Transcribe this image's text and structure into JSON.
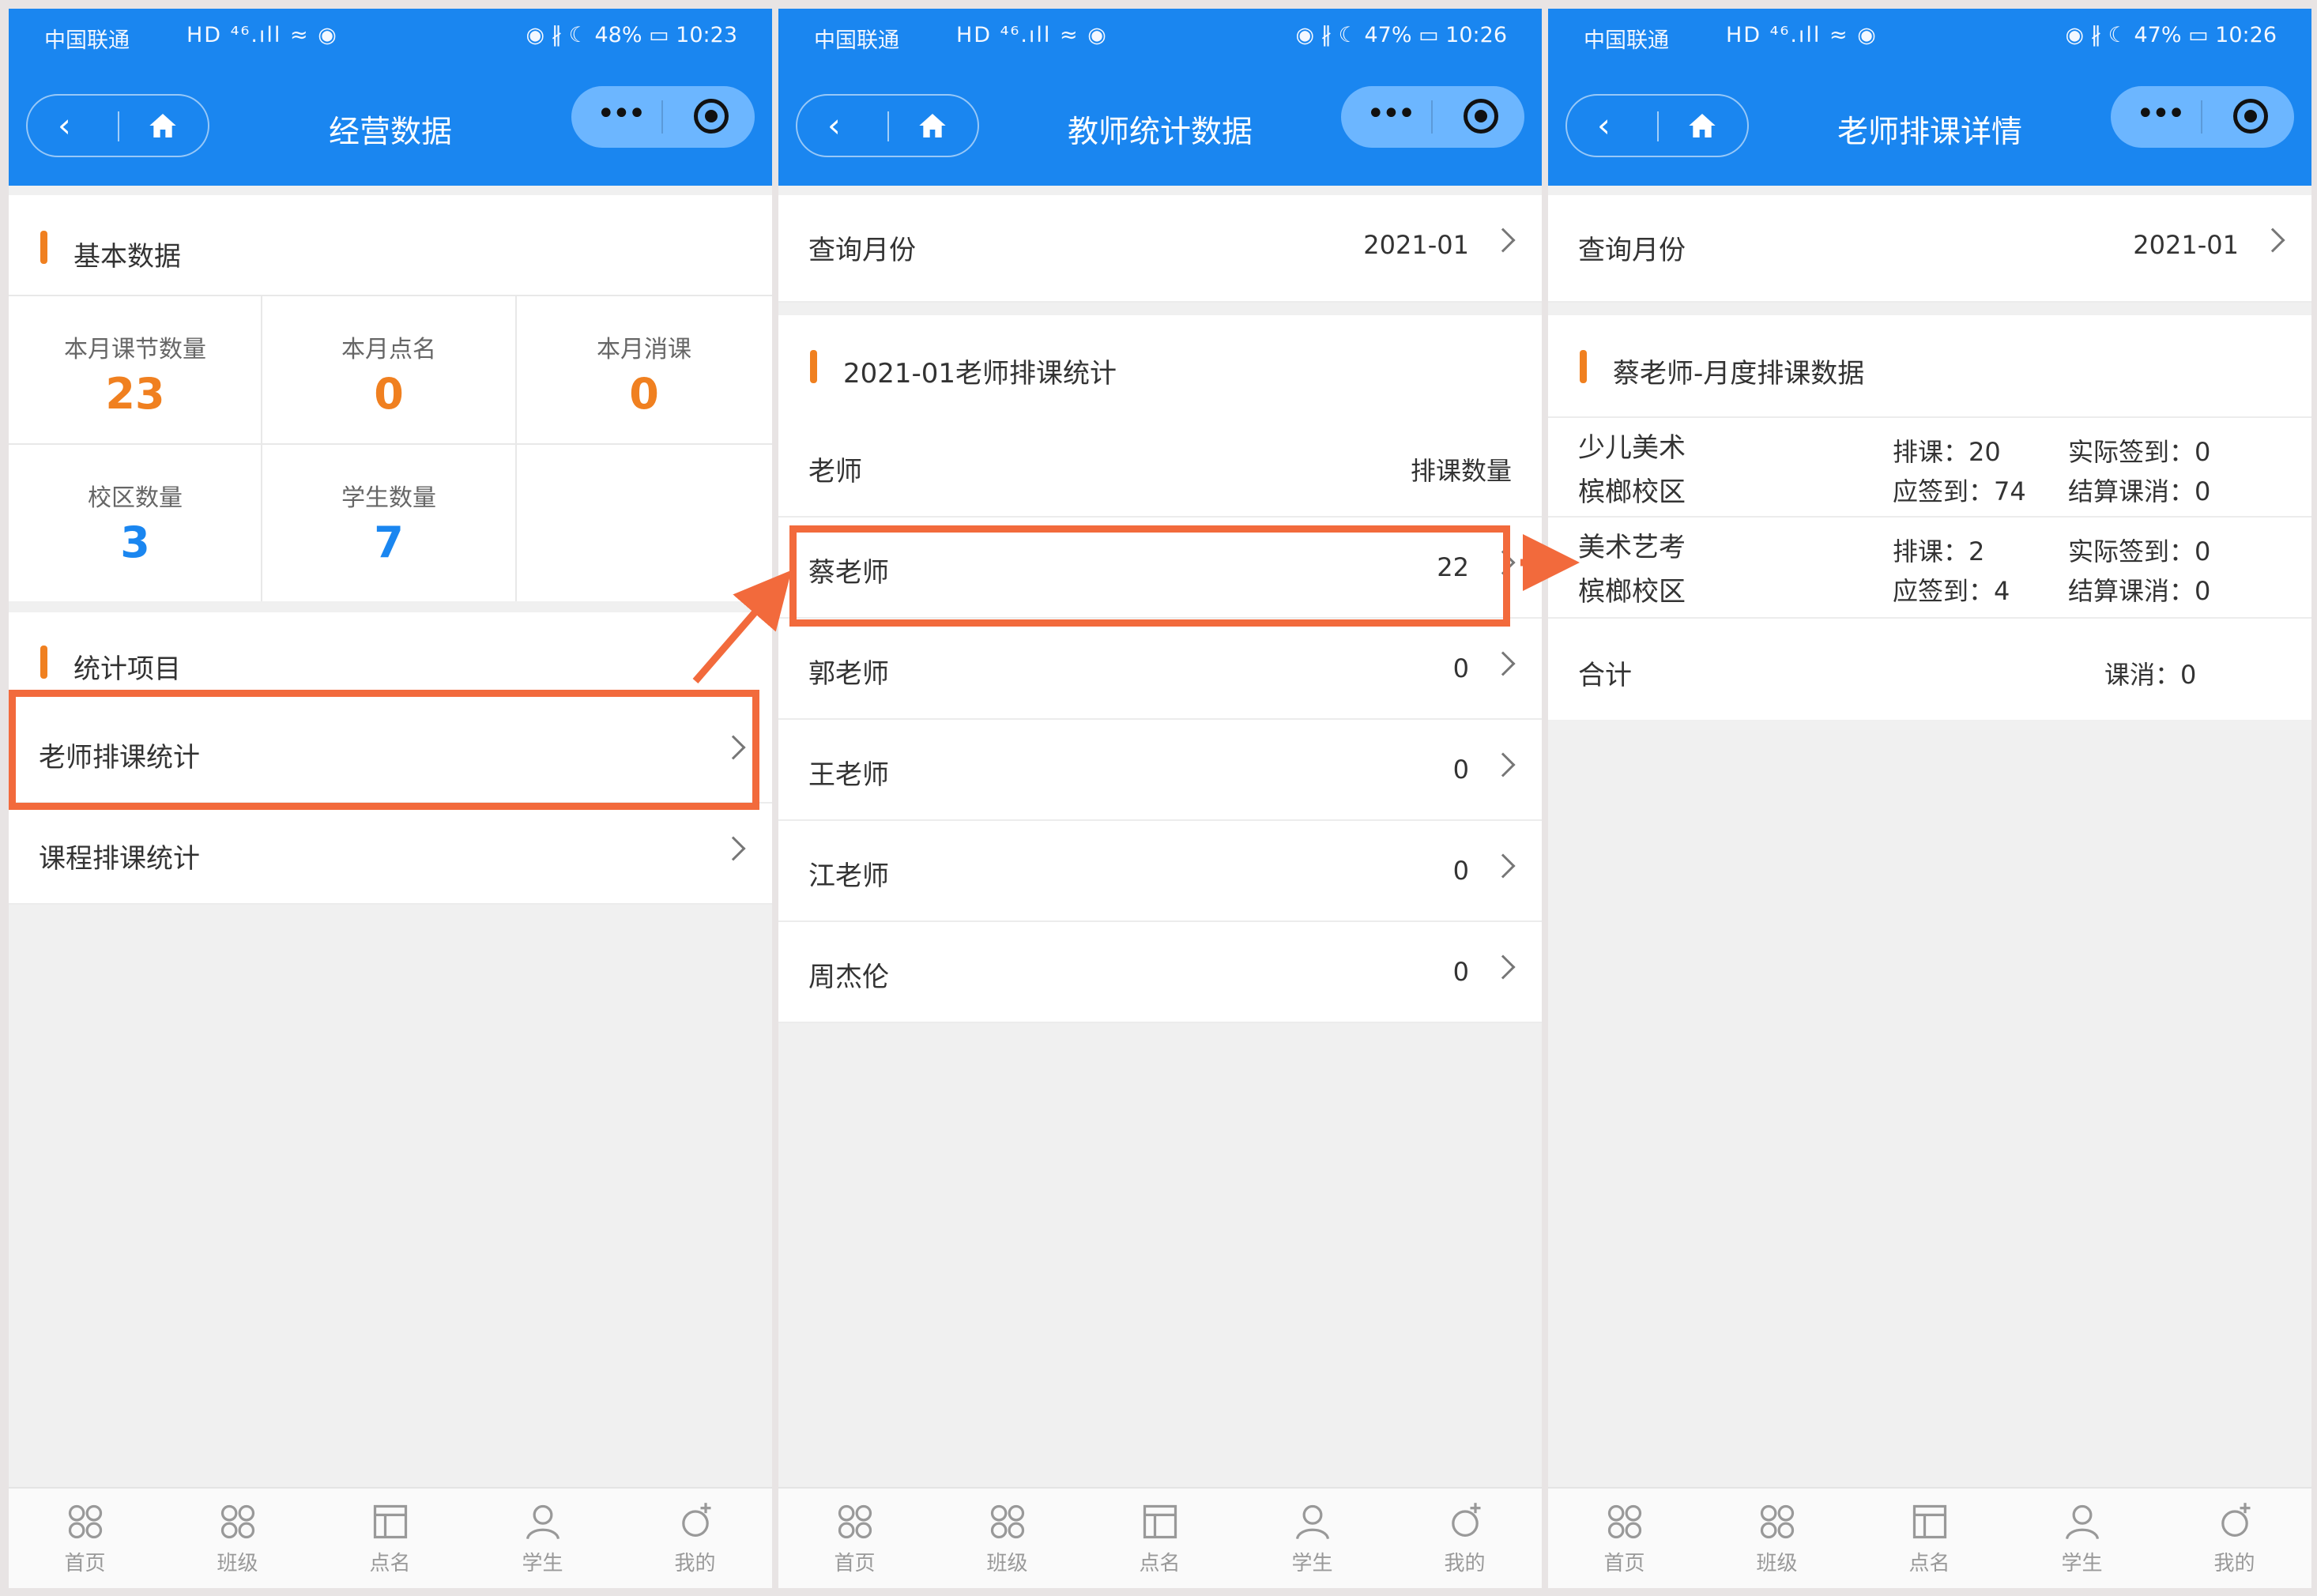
{
  "status": [
    {
      "carrier": "中国联通",
      "signal": "HD ⁴⁶.ıll ≈ ◉",
      "right": "◉ ∦ ☾ 48% ▭ 10:23"
    },
    {
      "carrier": "中国联通",
      "signal": "HD ⁴⁶.ıll ≈ ◉",
      "right": "◉ ∦ ☾ 47% ▭ 10:26"
    },
    {
      "carrier": "中国联通",
      "signal": "HD ⁴⁶.ıll ≈ ◉",
      "right": "◉ ∦ ☾ 47% ▭ 10:26"
    }
  ],
  "nav": {
    "back": "‹",
    "more": "•••"
  },
  "panel1": {
    "title": "经营数据",
    "basic_header": "基本数据",
    "stats": [
      {
        "label": "本月课节数量",
        "value": "23",
        "color": "#f08020"
      },
      {
        "label": "本月点名",
        "value": "0",
        "color": "#f08020"
      },
      {
        "label": "本月消课",
        "value": "0",
        "color": "#f08020"
      },
      {
        "label": "校区数量",
        "value": "3",
        "color": "#1a86f0"
      },
      {
        "label": "学生数量",
        "value": "7",
        "color": "#1a86f0"
      }
    ],
    "items_header": "统计项目",
    "items": [
      "老师排课统计",
      "课程排课统计"
    ]
  },
  "panel2": {
    "title": "教师统计数据",
    "month_label": "查询月份",
    "month_value": "2021-01",
    "section_title": "2021-01老师排课统计",
    "col_teacher": "老师",
    "col_count": "排课数量",
    "teachers": [
      {
        "name": "蔡老师",
        "count": "22"
      },
      {
        "name": "郭老师",
        "count": "0"
      },
      {
        "name": "王老师",
        "count": "0"
      },
      {
        "name": "江老师",
        "count": "0"
      },
      {
        "name": "周杰伦",
        "count": "0"
      }
    ]
  },
  "panel3": {
    "title": "老师排课详情",
    "month_label": "查询月份",
    "month_value": "2021-01",
    "section_title": "蔡老师-月度排课数据",
    "courses": [
      {
        "course": "少儿美术",
        "campus": "槟榔校区",
        "scheduled": "排课：20",
        "should_sign": "应签到：74",
        "actual_sign": "实际签到：0",
        "settled": "结算课消：0"
      },
      {
        "course": "美术艺考",
        "campus": "槟榔校区",
        "scheduled": "排课：2",
        "should_sign": "应签到：4",
        "actual_sign": "实际签到：0",
        "settled": "结算课消：0"
      }
    ],
    "total_label": "合计",
    "total_value": "课消：0"
  },
  "tabs": [
    "首页",
    "班级",
    "点名",
    "学生",
    "我的"
  ],
  "colors": {
    "brand": "#1a86f0",
    "accent": "#f08020",
    "highlight": "#f26a3c"
  }
}
